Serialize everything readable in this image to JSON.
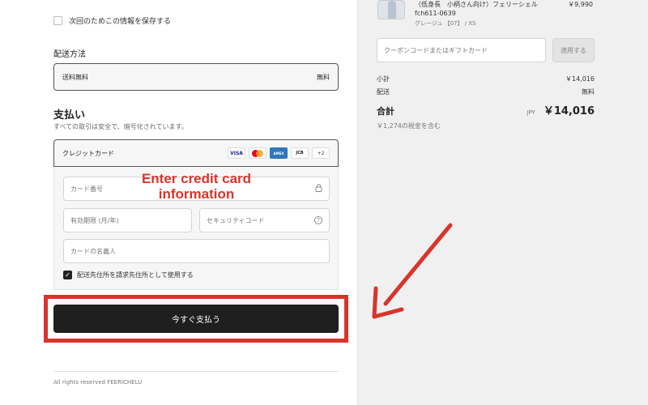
{
  "checkout": {
    "save_info_label": "次回のためこの情報を保存する",
    "shipping": {
      "title": "配送方法",
      "method": "送料無料",
      "price": "無料"
    },
    "payment": {
      "title": "支払い",
      "subtitle": "すべての取引は安全で、暗号化されています。",
      "method_label": "クレジットカード",
      "cards": [
        "VISA",
        "mastercard",
        "AMEX",
        "JCB",
        "+2"
      ],
      "card_number_placeholder": "カード番号",
      "expiry_placeholder": "有効期限 (月/年)",
      "security_code_placeholder": "セキュリティコード",
      "name_placeholder": "カードの名義人",
      "use_shipping_address_label": "配送先住所を請求先住所として使用する"
    },
    "pay_button_label": "今すぐ支払う",
    "footer": "All rights reserved FEERICHELU"
  },
  "annotation": {
    "text_line1": "Enter credit card",
    "text_line2": "information",
    "color": "#d9342b"
  },
  "summary": {
    "product": {
      "title": "（低身長　小柄さん向け）フェリーシェル",
      "code": "fch611-0639",
      "variant": "グレージュ 【07】 / XS",
      "price": "￥9,990"
    },
    "coupon_placeholder": "クーポンコードまたはギフトカード",
    "apply_label": "適用する",
    "subtotal_label": "小計",
    "subtotal": "￥14,016",
    "shipping_label": "配送",
    "shipping": "無料",
    "total_label": "合計",
    "currency": "JPY",
    "total": "￥14,016",
    "tax_note": "￥1,274の税金を含む"
  }
}
